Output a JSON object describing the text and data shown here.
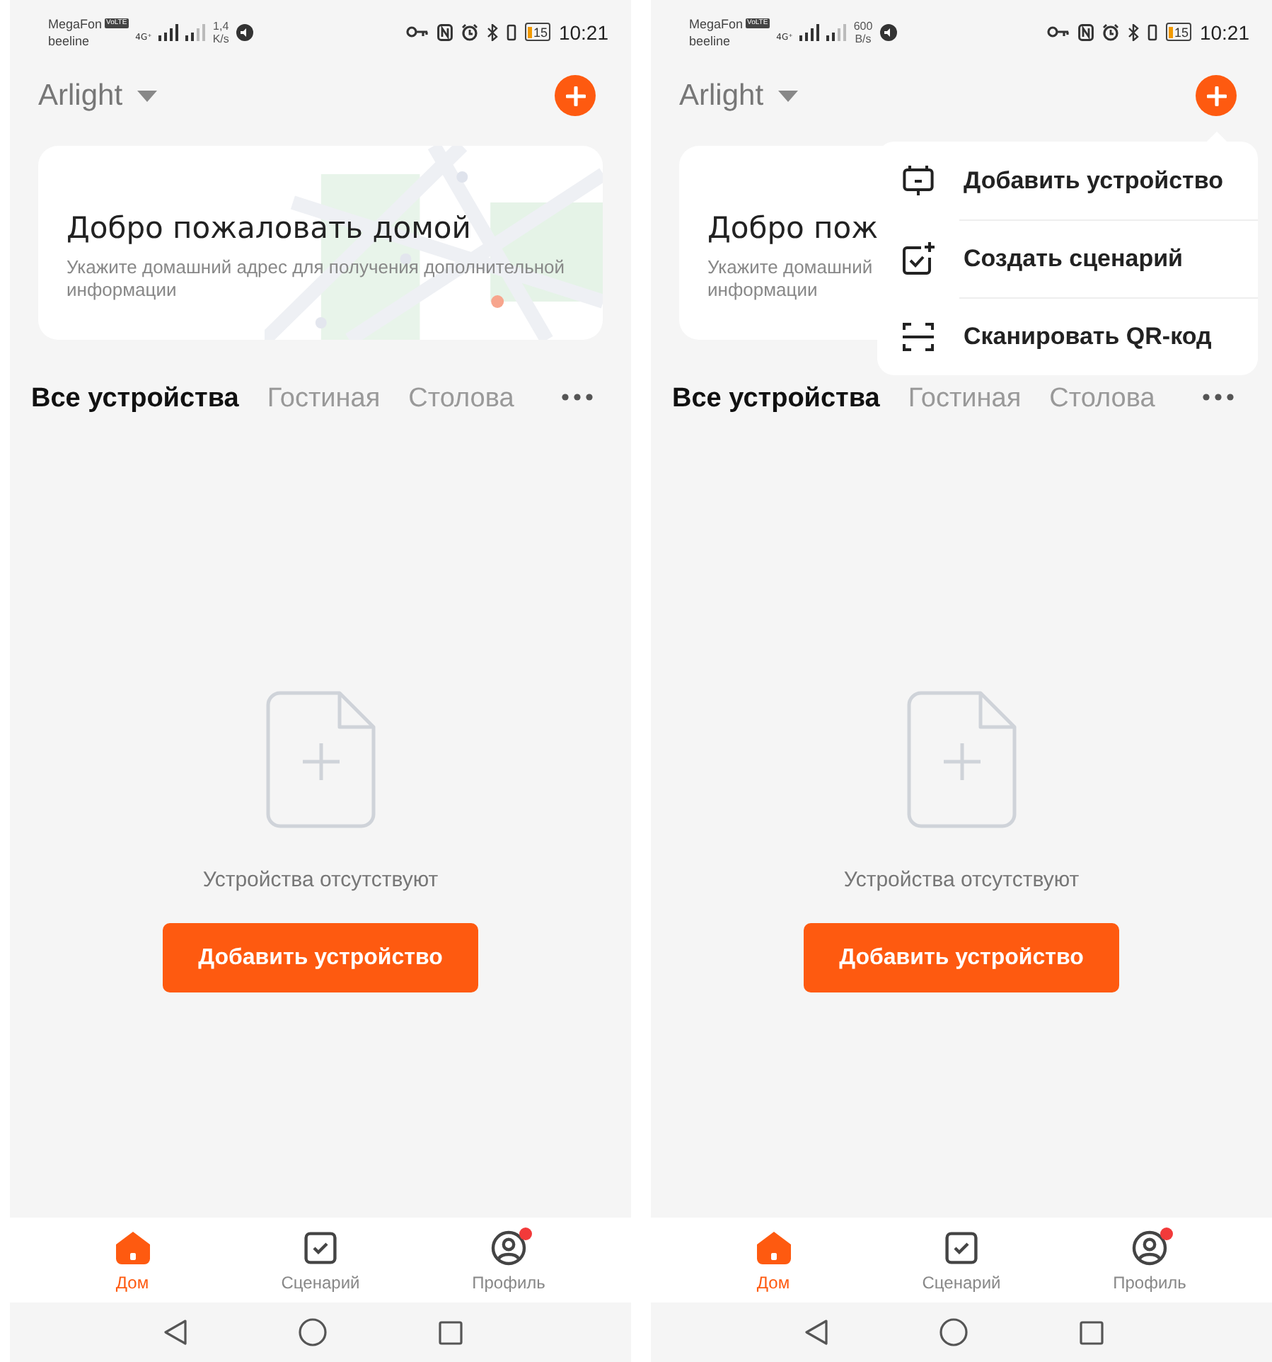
{
  "screens": [
    {
      "status_bar": {
        "carrier": "MegaFon",
        "volte": "VoLTE",
        "network": "4G⁺",
        "carrier2": "beeline",
        "speed_value": "1,4",
        "speed_unit": "K/s",
        "battery": "15",
        "time": "10:21"
      },
      "home_name": "Arlight",
      "welcome": {
        "title": "Добро пожаловать домой",
        "subtitle_lines": [
          "Укажите домашний адрес для получения дополнительной",
          "информации"
        ]
      },
      "tabs": [
        {
          "label": "Все устройства",
          "selected": true
        },
        {
          "label": "Гостиная",
          "selected": false
        },
        {
          "label": "Столова",
          "selected": false
        }
      ],
      "empty": {
        "message": "Устройства отсутствуют",
        "button": "Добавить устройство"
      },
      "nav": [
        {
          "label": "Дом",
          "selected": true,
          "kind": "home",
          "badge": false
        },
        {
          "label": "Сценарий",
          "selected": false,
          "kind": "scene",
          "badge": false
        },
        {
          "label": "Профиль",
          "selected": false,
          "kind": "profile",
          "badge": true
        }
      ]
    },
    {
      "status_bar": {
        "carrier": "MegaFon",
        "volte": "VoLTE",
        "network": "4G⁺",
        "carrier2": "beeline",
        "speed_value": "600",
        "speed_unit": "B/s",
        "battery": "15",
        "time": "10:21"
      },
      "home_name": "Arlight",
      "welcome": {
        "title": "Добро пож",
        "subtitle_lines": [
          "Укажите домашний",
          "информации"
        ]
      },
      "tabs": [
        {
          "label": "Все устройства",
          "selected": true
        },
        {
          "label": "Гостиная",
          "selected": false
        },
        {
          "label": "Столова",
          "selected": false
        }
      ],
      "empty": {
        "message": "Устройства отсутствуют",
        "button": "Добавить устройство"
      },
      "menu": [
        {
          "kind": "device",
          "label": "Добавить устройство"
        },
        {
          "kind": "scene",
          "label": "Создать сценарий"
        },
        {
          "kind": "qr",
          "label": "Сканировать QR-код"
        }
      ],
      "nav": [
        {
          "label": "Дом",
          "selected": true,
          "kind": "home",
          "badge": false
        },
        {
          "label": "Сценарий",
          "selected": false,
          "kind": "scene",
          "badge": false
        },
        {
          "label": "Профиль",
          "selected": false,
          "kind": "profile",
          "badge": true
        }
      ]
    }
  ]
}
